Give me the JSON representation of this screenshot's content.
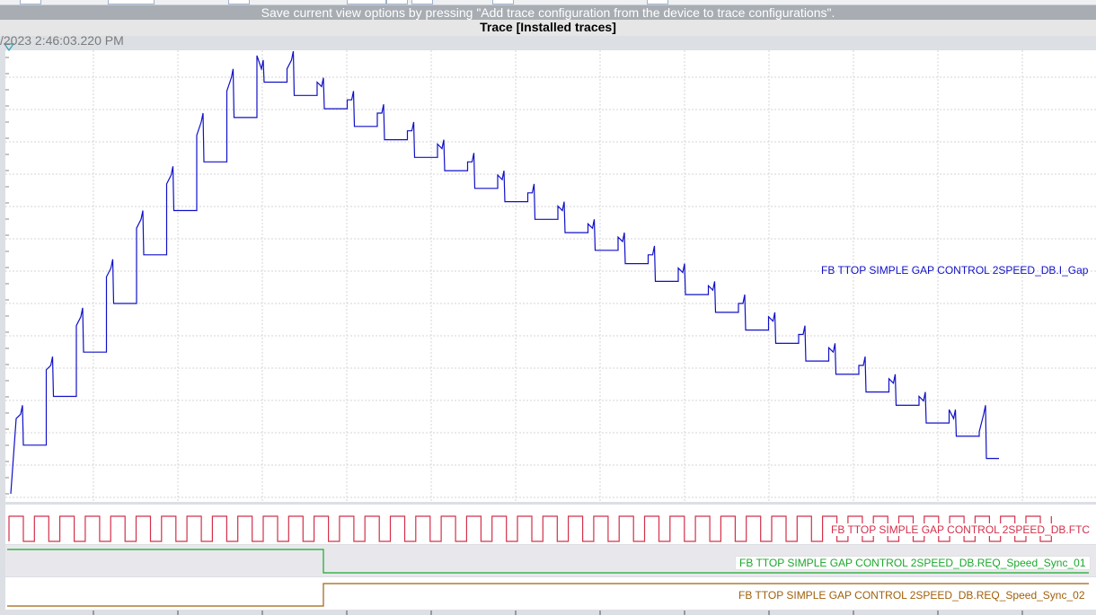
{
  "banner_text": "Save current view options by pressing \"Add trace configuration from the device to trace configurations\".",
  "trace_title": "Trace [Installed traces]",
  "timestamp_label": "/2023 2:46:03.220 PM",
  "chart_data": {
    "type": "line",
    "title": "Trace [Installed traces]",
    "xlabel": "",
    "ylabel": "",
    "grid": true,
    "legend": "inline labels at right",
    "series": [
      {
        "name": "FB TTOP SIMPLE GAP CONTROL 2SPEED_DB.I_Gap",
        "color": "#1010c8",
        "description_values": "relative analog level 0-1 per sawtooth cycle (peak, settled)",
        "cycles": [
          [
            0.2,
            0.11
          ],
          [
            0.31,
            0.22
          ],
          [
            0.42,
            0.32
          ],
          [
            0.53,
            0.43
          ],
          [
            0.64,
            0.54
          ],
          [
            0.74,
            0.64
          ],
          [
            0.86,
            0.75
          ],
          [
            0.96,
            0.85
          ],
          [
            0.98,
            0.93
          ],
          [
            1.0,
            0.9
          ],
          [
            0.94,
            0.87
          ],
          [
            0.91,
            0.83
          ],
          [
            0.88,
            0.8
          ],
          [
            0.84,
            0.76
          ],
          [
            0.8,
            0.73
          ],
          [
            0.77,
            0.69
          ],
          [
            0.73,
            0.66
          ],
          [
            0.7,
            0.62
          ],
          [
            0.66,
            0.59
          ],
          [
            0.62,
            0.55
          ],
          [
            0.59,
            0.52
          ],
          [
            0.56,
            0.48
          ],
          [
            0.52,
            0.45
          ],
          [
            0.48,
            0.41
          ],
          [
            0.45,
            0.37
          ],
          [
            0.41,
            0.34
          ],
          [
            0.38,
            0.3
          ],
          [
            0.34,
            0.27
          ],
          [
            0.31,
            0.23
          ],
          [
            0.27,
            0.2
          ],
          [
            0.23,
            0.16
          ],
          [
            0.19,
            0.13
          ],
          [
            0.2,
            0.08
          ]
        ]
      },
      {
        "name": "FB TTOP SIMPLE GAP CONTROL 2SPEED_DB.FTC",
        "color": "#d2304a",
        "type": "digital",
        "pulse_count": 41
      },
      {
        "name": "FB TTOP SIMPLE GAP CONTROL 2SPEED_DB.REQ_Speed_Sync_01",
        "color": "#1aa82c",
        "type": "digital",
        "state": "high then falls to low at ~31% of window"
      },
      {
        "name": "FB TTOP SIMPLE GAP CONTROL 2SPEED_DB.REQ_Speed_Sync_02",
        "color": "#a0600c",
        "type": "digital",
        "state": "low then rises to high at ~31% of window"
      }
    ]
  }
}
